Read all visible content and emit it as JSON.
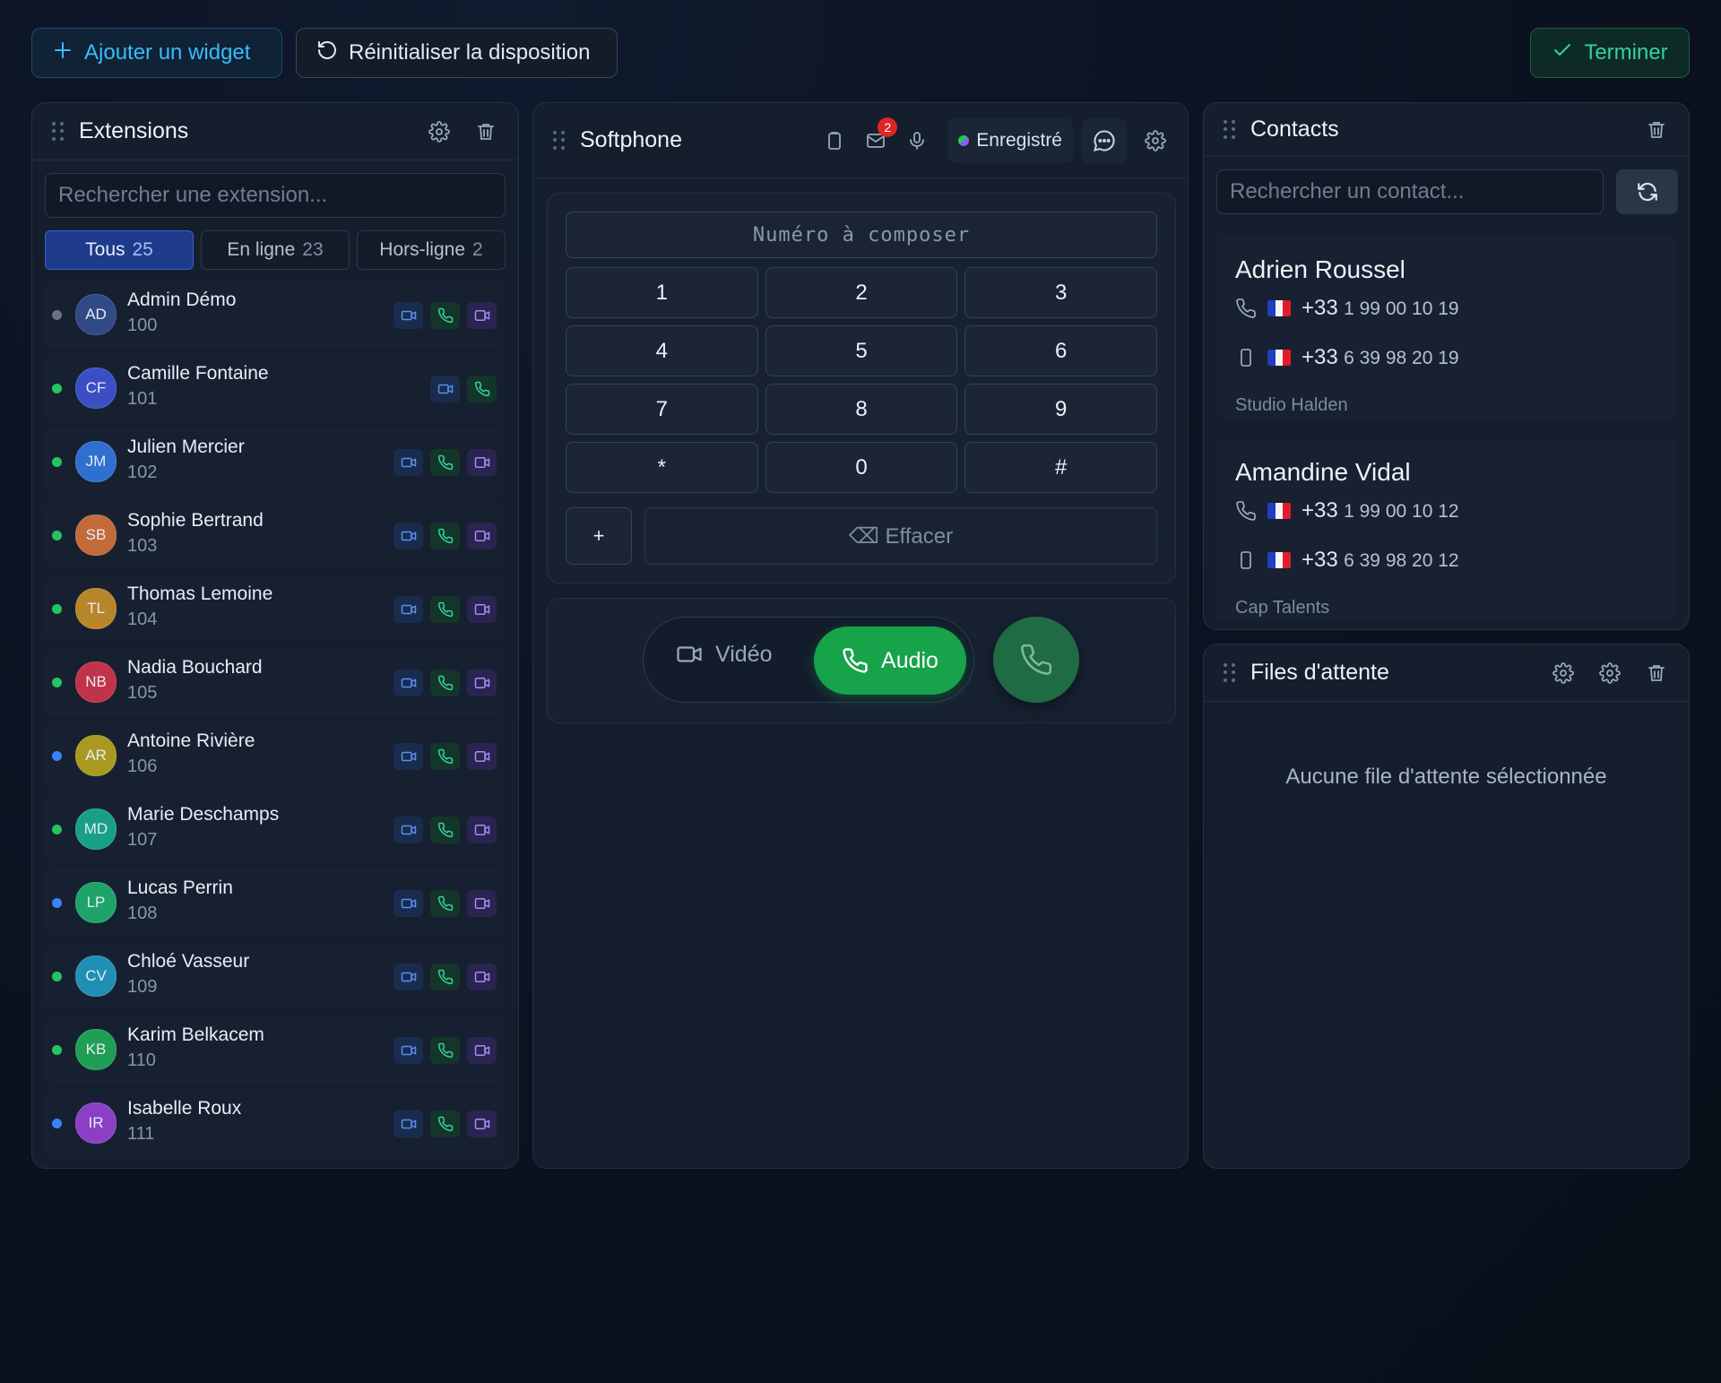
{
  "toolbar": {
    "add_widget": "Ajouter un widget",
    "reset_layout": "Réinitialiser la disposition",
    "done": "Terminer"
  },
  "extensions": {
    "title": "Extensions",
    "search_placeholder": "Rechercher une extension...",
    "tabs": [
      {
        "label": "Tous",
        "count": "25",
        "active": true
      },
      {
        "label": "En ligne",
        "count": "23",
        "active": false
      },
      {
        "label": "Hors-ligne",
        "count": "2",
        "active": false
      }
    ],
    "items": [
      {
        "initials": "AD",
        "name": "Admin Démo",
        "number": "100",
        "status": "offline",
        "status_color": "#6b7280",
        "avatar_color": "#2f4a86",
        "actions": [
          "video",
          "audio",
          "screen"
        ]
      },
      {
        "initials": "CF",
        "name": "Camille Fontaine",
        "number": "101",
        "status": "online",
        "status_color": "#22c55e",
        "avatar_color": "#3b4fc4",
        "actions": [
          "video",
          "audio"
        ]
      },
      {
        "initials": "JM",
        "name": "Julien Mercier",
        "number": "102",
        "status": "online",
        "status_color": "#22c55e",
        "avatar_color": "#2f6fd0",
        "actions": [
          "video",
          "audio",
          "screen"
        ]
      },
      {
        "initials": "SB",
        "name": "Sophie Bertrand",
        "number": "103",
        "status": "online",
        "status_color": "#22c55e",
        "avatar_color": "#c26a3a",
        "actions": [
          "video",
          "audio",
          "screen"
        ]
      },
      {
        "initials": "TL",
        "name": "Thomas Lemoine",
        "number": "104",
        "status": "online",
        "status_color": "#22c55e",
        "avatar_color": "#b8862a",
        "actions": [
          "video",
          "audio",
          "screen"
        ]
      },
      {
        "initials": "NB",
        "name": "Nadia Bouchard",
        "number": "105",
        "status": "online",
        "status_color": "#22c55e",
        "avatar_color": "#c0334a",
        "actions": [
          "video",
          "audio",
          "screen"
        ]
      },
      {
        "initials": "AR",
        "name": "Antoine Rivière",
        "number": "106",
        "status": "busy",
        "status_color": "#3b82f6",
        "avatar_color": "#a89a20",
        "actions": [
          "video",
          "audio",
          "screen"
        ]
      },
      {
        "initials": "MD",
        "name": "Marie Deschamps",
        "number": "107",
        "status": "online",
        "status_color": "#22c55e",
        "avatar_color": "#17a085",
        "actions": [
          "video",
          "audio",
          "screen"
        ]
      },
      {
        "initials": "LP",
        "name": "Lucas Perrin",
        "number": "108",
        "status": "busy",
        "status_color": "#3b82f6",
        "avatar_color": "#1fa36a",
        "actions": [
          "video",
          "audio",
          "screen"
        ]
      },
      {
        "initials": "CV",
        "name": "Chloé Vasseur",
        "number": "109",
        "status": "online",
        "status_color": "#22c55e",
        "avatar_color": "#1f8fb5",
        "actions": [
          "video",
          "audio",
          "screen"
        ]
      },
      {
        "initials": "KB",
        "name": "Karim Belkacem",
        "number": "110",
        "status": "online",
        "status_color": "#22c55e",
        "avatar_color": "#1f9e56",
        "actions": [
          "video",
          "audio",
          "screen"
        ]
      },
      {
        "initials": "IR",
        "name": "Isabelle Roux",
        "number": "111",
        "status": "busy",
        "status_color": "#3b82f6",
        "avatar_color": "#8b3fc4",
        "actions": [
          "video",
          "audio",
          "screen"
        ]
      }
    ]
  },
  "softphone": {
    "title": "Softphone",
    "voicemail_count": "2",
    "registration_status": "Enregistré",
    "dial_placeholder": "Numéro à composer",
    "keys": [
      "1",
      "2",
      "3",
      "4",
      "5",
      "6",
      "7",
      "8",
      "9",
      "*",
      "0",
      "#"
    ],
    "plus_key": "+",
    "clear_label": "⌫ Effacer",
    "mode_video": "Vidéo",
    "mode_audio": "Audio",
    "selected_mode": "audio"
  },
  "contacts": {
    "title": "Contacts",
    "search_placeholder": "Rechercher un contact...",
    "items": [
      {
        "name": "Adrien Roussel",
        "phone_cc": "+33",
        "phone_rest": "1 99 00 10 19",
        "mobile_cc": "+33",
        "mobile_rest": "6 39 98 20 19",
        "company": "Studio Halden"
      },
      {
        "name": "Amandine Vidal",
        "phone_cc": "+33",
        "phone_rest": "1 99 00 10 12",
        "mobile_cc": "+33",
        "mobile_rest": "6 39 98 20 12",
        "company": "Cap Talents"
      }
    ]
  },
  "queues": {
    "title": "Files d'attente",
    "empty_message": "Aucune file d'attente sélectionnée"
  },
  "colors": {
    "accent_blue": "#38bdf8",
    "accent_green": "#16a34a",
    "done_green": "#34d399",
    "badge_red": "#dc2626",
    "flag_blue": "#1e3fbf",
    "flag_white": "#f4f4f4",
    "flag_red": "#e11d2a"
  }
}
